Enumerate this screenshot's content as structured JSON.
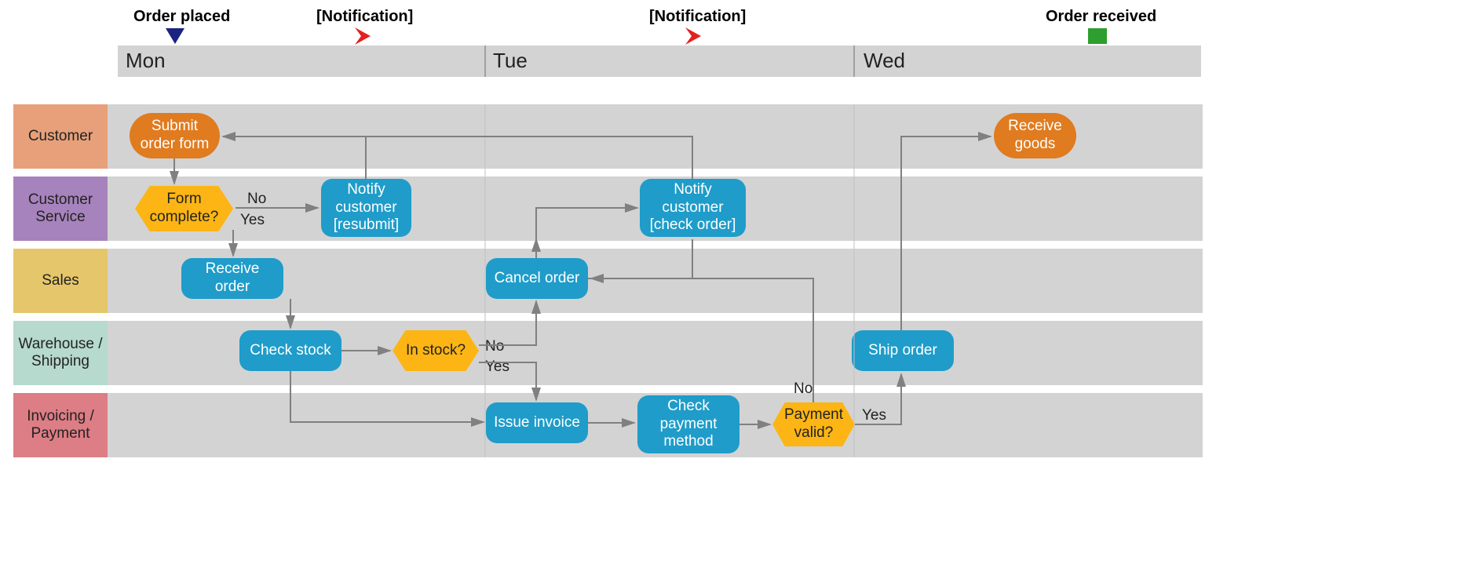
{
  "milestones": {
    "order_placed": "Order placed",
    "notification1": "[Notification]",
    "notification2": "[Notification]",
    "order_received": "Order received"
  },
  "timeline": {
    "mon": "Mon",
    "tue": "Tue",
    "wed": "Wed"
  },
  "lanes": {
    "customer": "Customer",
    "customer_service": "Customer Service",
    "sales": "Sales",
    "warehouse": "Warehouse / Shipping",
    "invoicing": "Invoicing / Payment"
  },
  "nodes": {
    "submit_order_form": "Submit order form",
    "receive_goods": "Receive goods",
    "form_complete": "Form complete?",
    "notify_resubmit": "Notify customer [resubmit]",
    "notify_check_order": "Notify customer [check order]",
    "receive_order": "Receive order",
    "cancel_order": "Cancel order",
    "check_stock": "Check stock",
    "in_stock": "In stock?",
    "ship_order": "Ship order",
    "issue_invoice": "Issue invoice",
    "check_payment_method": "Check payment method",
    "payment_valid": "Payment valid?"
  },
  "edge_labels": {
    "no": "No",
    "yes": "Yes"
  },
  "lane_colors": {
    "customer": "#e7a07a",
    "customer_service": "#a783bd",
    "sales": "#e5c66a",
    "warehouse": "#b6dacd",
    "invoicing": "#dd7d85"
  },
  "colors": {
    "task": "#1f9cc9",
    "pill": "#e07b1f",
    "decision": "#fcb514",
    "timeline_bg": "#d3d3d3",
    "arrow": "#808080",
    "chevron": "#e3211d",
    "triangle": "#1a237e",
    "square": "#2e9e2e"
  }
}
